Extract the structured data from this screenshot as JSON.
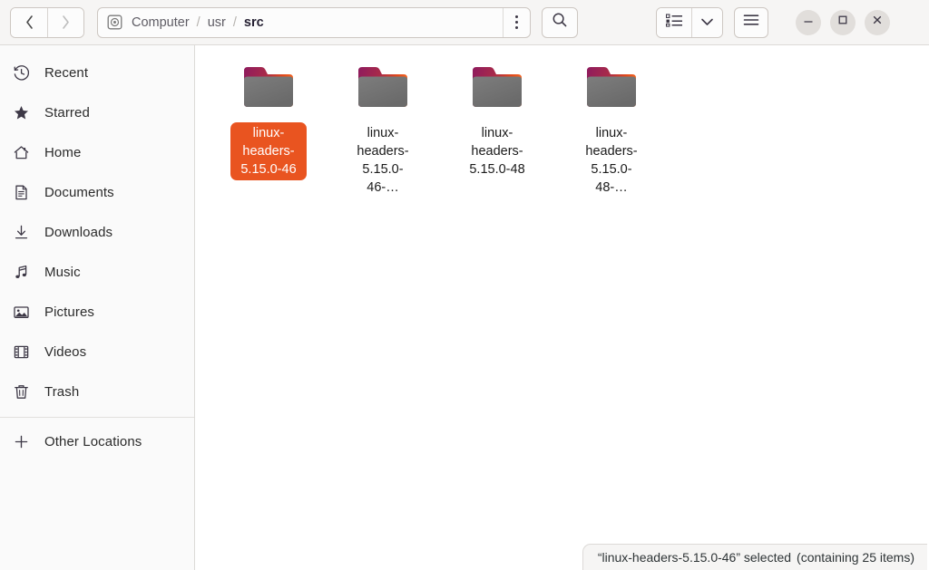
{
  "window": {
    "controls": [
      {
        "name": "minimize",
        "glyph": "minimize-icon"
      },
      {
        "name": "maximize",
        "glyph": "maximize-icon"
      },
      {
        "name": "close",
        "glyph": "close-icon"
      }
    ]
  },
  "headerbar": {
    "back_label": "‹",
    "forward_label": "›",
    "pathbar": {
      "disk_icon": "computer-disk-icon",
      "crumbs": [
        {
          "label": "Computer",
          "current": false
        },
        {
          "label": "usr",
          "current": false
        },
        {
          "label": "src",
          "current": true
        }
      ],
      "separator": "/",
      "menu_icon": "three-dots-vertical-icon"
    },
    "search_icon": "search-icon",
    "view_icon": "list-view-icon",
    "view_dropdown_icon": "chevron-down-icon",
    "menu_icon": "hamburger-menu-icon"
  },
  "sidebar": {
    "items": [
      {
        "label": "Recent",
        "icon": "clock-icon"
      },
      {
        "label": "Starred",
        "icon": "star-icon"
      },
      {
        "label": "Home",
        "icon": "home-icon"
      },
      {
        "label": "Documents",
        "icon": "document-icon"
      },
      {
        "label": "Downloads",
        "icon": "download-icon"
      },
      {
        "label": "Music",
        "icon": "music-note-icon"
      },
      {
        "label": "Pictures",
        "icon": "picture-icon"
      },
      {
        "label": "Videos",
        "icon": "video-film-icon"
      },
      {
        "label": "Trash",
        "icon": "trash-icon"
      }
    ],
    "other_locations": {
      "label": "Other Locations",
      "icon": "plus-icon"
    }
  },
  "content": {
    "files": [
      {
        "name": "linux-headers-5.15.0-46",
        "icon": "folder-icon",
        "selected": true
      },
      {
        "name": "linux-headers-5.15.0-46-…",
        "icon": "folder-icon",
        "selected": false
      },
      {
        "name": "linux-headers-5.15.0-48",
        "icon": "folder-icon",
        "selected": false
      },
      {
        "name": "linux-headers-5.15.0-48-…",
        "icon": "folder-icon",
        "selected": false
      }
    ]
  },
  "statusbar": {
    "selection_text": "“linux-headers-5.15.0-46” selected",
    "detail_text": "(containing 25 items)"
  },
  "colors": {
    "accent": "#e95420",
    "headerbar_bg": "#f6f5f4",
    "sidebar_bg": "#fafafa",
    "content_bg": "#ffffff",
    "border": "#dcdad7",
    "text": "#2e3436"
  }
}
